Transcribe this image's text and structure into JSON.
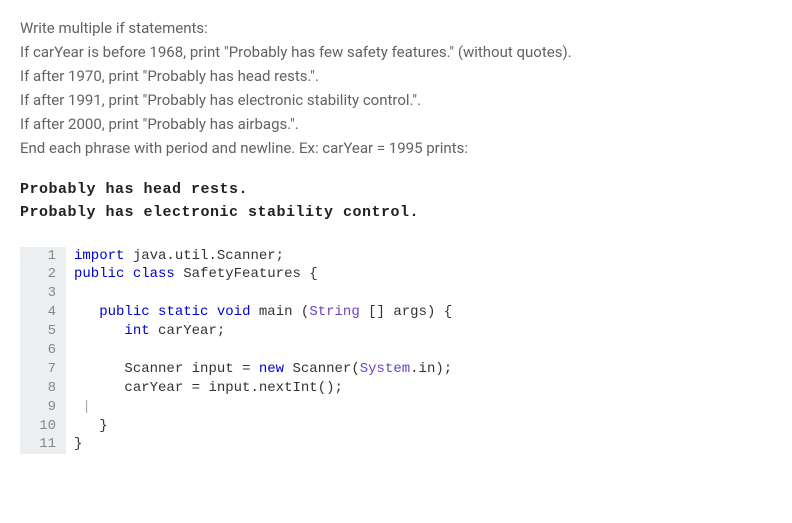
{
  "instructions": {
    "line1": "Write multiple if statements:",
    "line2": "If carYear is before 1968, print \"Probably has few safety features.\" (without quotes).",
    "line3": "If after 1970, print \"Probably has head rests.\".",
    "line4": "If after 1991, print \"Probably has electronic stability control.\".",
    "line5": "If after 2000, print \"Probably has airbags.\".",
    "line6": "End each phrase with period and newline. Ex: carYear = 1995 prints:"
  },
  "example_output": {
    "line1": "Probably has head rests.",
    "line2": "Probably has electronic stability control."
  },
  "code": {
    "gutter": [
      "1",
      "2",
      "3",
      "4",
      "5",
      "6",
      "7",
      "8",
      "9",
      "10",
      "11"
    ],
    "tokens": {
      "import": "import",
      "pkg": "java.util.Scanner",
      "public": "public",
      "class": "class",
      "classname": "SafetyFeatures",
      "static": "static",
      "void": "void",
      "main": "main",
      "String": "String",
      "args": "args",
      "int": "int",
      "varCarYear": "carYear",
      "Scanner": "Scanner",
      "inputVar": "input",
      "new": "new",
      "System": "System",
      "in": "in",
      "nextInt": "nextInt"
    }
  }
}
